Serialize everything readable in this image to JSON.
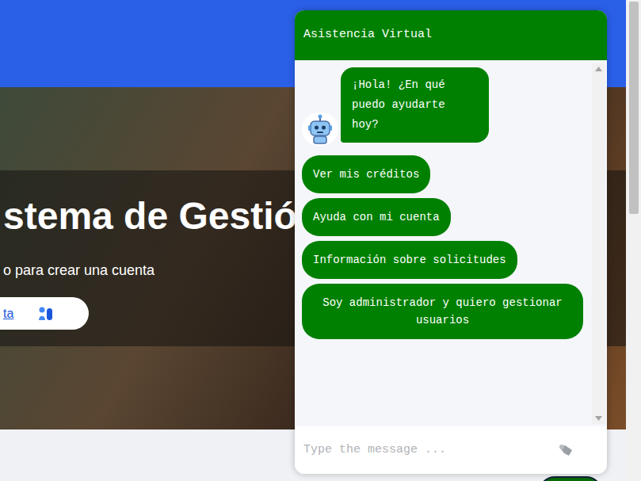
{
  "page": {
    "hero": {
      "title": "stema de Gestió",
      "subtitle": "o para crear una cuenta",
      "button": "ta"
    }
  },
  "chat": {
    "title": "Asistencia Virtual",
    "messages": [
      {
        "from": "bot",
        "text": "¡Hola! ¿En qué puedo ayudarte hoy?"
      }
    ],
    "options": [
      "Ver mis créditos",
      "Ayuda con mi cuenta",
      "Información sobre solicitudes",
      "Soy administrador y quiero gestionar usuarios"
    ],
    "input": {
      "placeholder": "Type the message ..."
    }
  }
}
